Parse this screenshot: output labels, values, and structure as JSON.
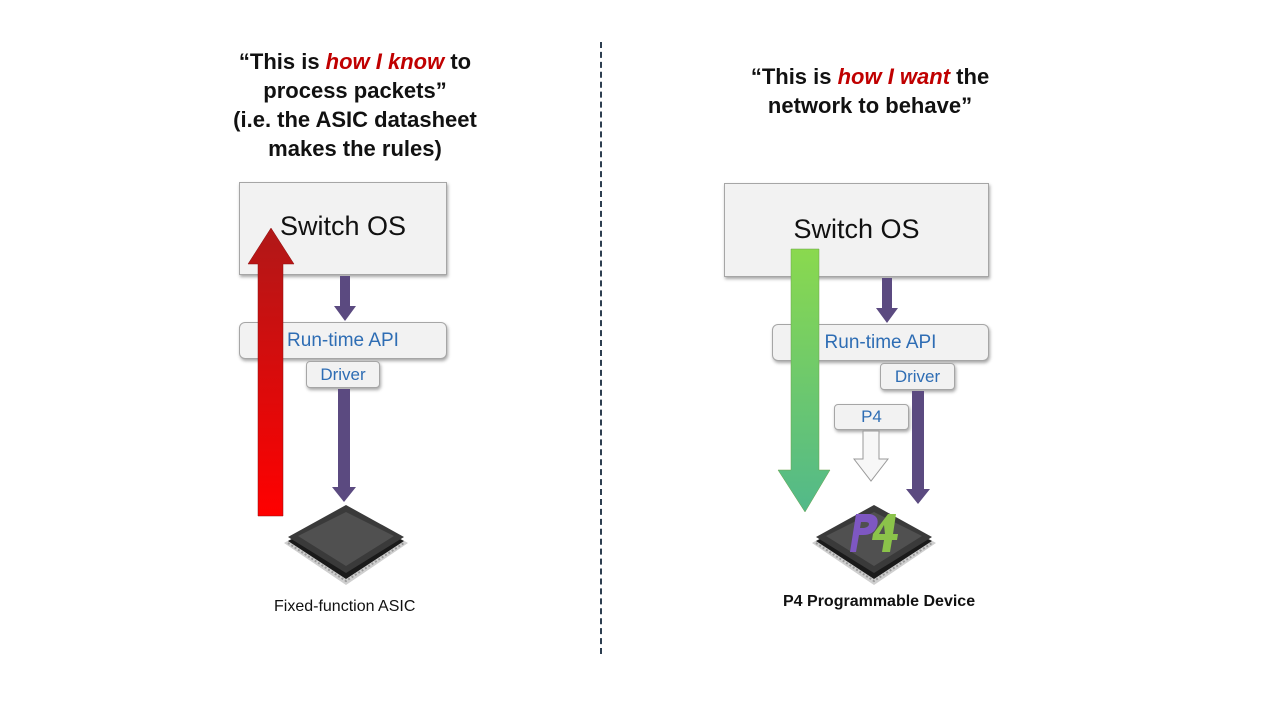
{
  "left": {
    "quote": {
      "open": "“This is ",
      "highlight": "how I know",
      "rest1": " to",
      "line2": "process packets”",
      "line3": "(i.e. the ASIC datasheet",
      "line4": "makes the rules)"
    },
    "switch_os": "Switch OS",
    "runtime_api": "Run-time API",
    "driver": "Driver",
    "device_label": "Fixed-function ASIC"
  },
  "right": {
    "quote": {
      "open": "“This is ",
      "highlight": "how I want",
      "rest1": " the",
      "line2": "network to behave”"
    },
    "switch_os": "Switch OS",
    "runtime_api": "Run-time API",
    "driver": "Driver",
    "p4_box": "P4",
    "device_label": "P4 Programmable Device",
    "chip_logo": "P4"
  },
  "colors": {
    "highlight": "#c00000",
    "api_text": "#2e6db4",
    "arrow_purple": "#5b4a80",
    "arrow_red": "#e00000",
    "arrow_green": "#5dc46a",
    "logo_purple": "#7e57c2",
    "logo_green": "#8bc34a"
  }
}
